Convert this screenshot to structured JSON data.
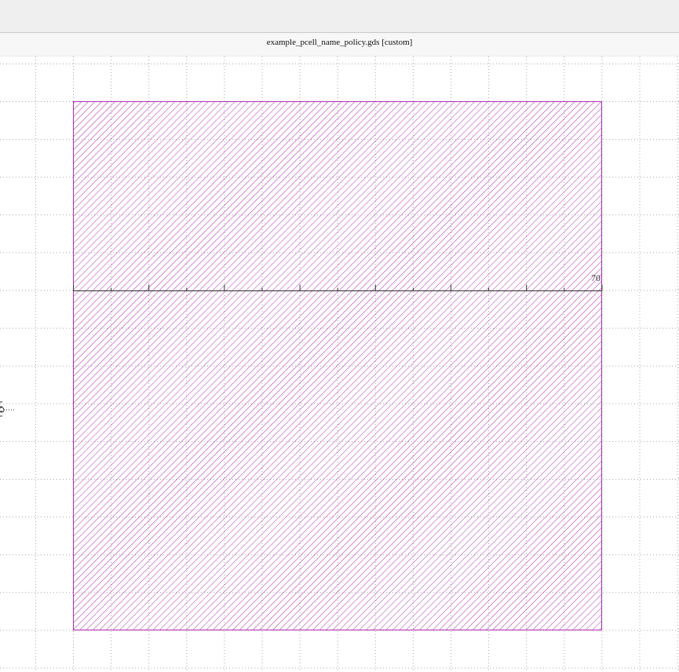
{
  "window": {
    "title": "example_pcell_name_policy.gds [custom]"
  },
  "layout_view": {
    "ruler_label": "70",
    "shape_color": "#b02eb0",
    "grid_color": "#a8a8a8",
    "ruler_color": "#333333"
  }
}
